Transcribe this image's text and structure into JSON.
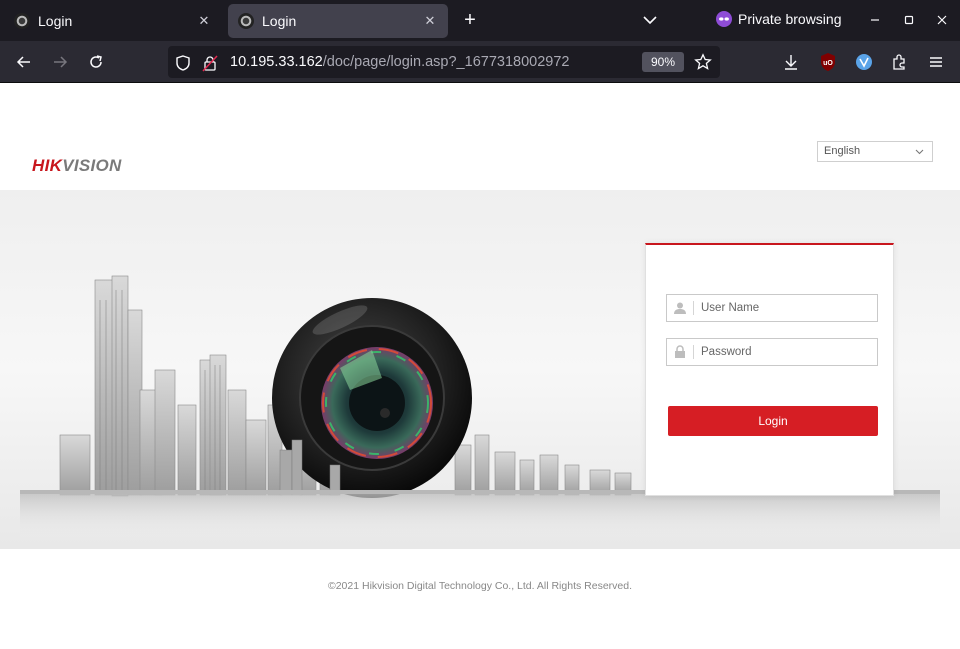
{
  "browser": {
    "tabs": [
      {
        "title": "Login",
        "active": false
      },
      {
        "title": "Login",
        "active": true
      }
    ],
    "private_label": "Private browsing",
    "url_host": "10.195.33.162",
    "url_path": "/doc/page/login.asp?_1677318002972",
    "zoom": "90%"
  },
  "page": {
    "logo_hik": "HIK",
    "logo_vision": "VISION",
    "language": "English",
    "username_placeholder": "User Name",
    "password_placeholder": "Password",
    "login_label": "Login",
    "copyright": "©2021 Hikvision Digital Technology Co., Ltd. All Rights Reserved."
  },
  "colors": {
    "brand_red": "#d61e24",
    "tab_bar": "#1c1b22",
    "nav_bar": "#2b2a33"
  }
}
